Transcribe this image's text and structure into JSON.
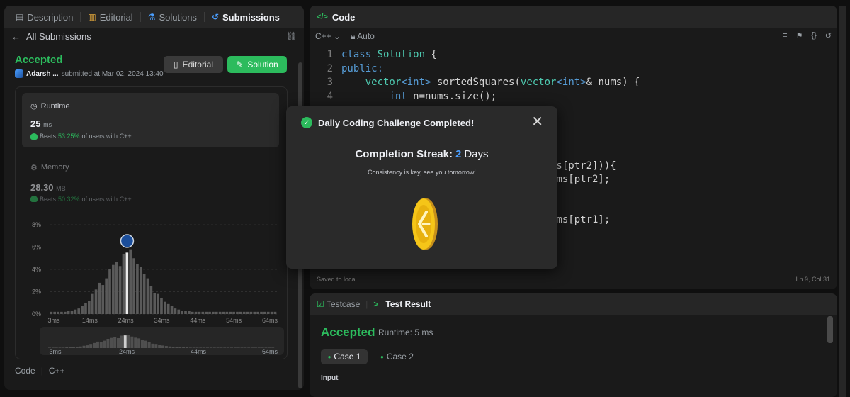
{
  "left_tabs": [
    {
      "icon": "description-icon",
      "label": "Description"
    },
    {
      "icon": "book-icon",
      "label": "Editorial"
    },
    {
      "icon": "flask-icon",
      "label": "Solutions"
    },
    {
      "icon": "history-icon",
      "label": "Submissions"
    }
  ],
  "submission": {
    "back_label": "All Submissions",
    "status": "Accepted",
    "user": "Adarsh ...",
    "submitted_text": "submitted at Mar 02, 2024 13:40",
    "editorial_btn": "Editorial",
    "solution_btn": "Solution"
  },
  "runtime": {
    "title": "Runtime",
    "value": "25",
    "unit": "ms",
    "beats_prefix": "Beats",
    "beats_pct": "53.25%",
    "beats_suffix": "of users with C++"
  },
  "memory": {
    "title": "Memory",
    "value": "28.30",
    "unit": "MB",
    "beats_prefix": "Beats",
    "beats_pct": "50.32%",
    "beats_suffix": "of users with C++"
  },
  "chart_data": {
    "type": "bar",
    "title": "",
    "xlabel": "",
    "ylabel": "",
    "ylim": [
      0,
      8
    ],
    "yticks": [
      "8%",
      "6%",
      "4%",
      "2%",
      "0%"
    ],
    "xticks": [
      "3ms",
      "14ms",
      "24ms",
      "34ms",
      "44ms",
      "54ms",
      "64ms"
    ],
    "mini_xticks": [
      "3ms",
      "24ms",
      "44ms",
      "64ms"
    ],
    "highlight_index": 22,
    "highlight_value": 5.5,
    "values": [
      0.2,
      0.2,
      0.2,
      0.2,
      0.2,
      0.3,
      0.3,
      0.4,
      0.5,
      0.7,
      1.0,
      1.2,
      1.8,
      2.2,
      2.8,
      2.6,
      3.2,
      4.0,
      4.4,
      4.7,
      4.3,
      5.4,
      5.5,
      5.8,
      5.0,
      4.5,
      4.2,
      3.6,
      3.2,
      2.5,
      1.9,
      1.8,
      1.4,
      1.1,
      0.9,
      0.7,
      0.5,
      0.4,
      0.3,
      0.3,
      0.3,
      0.2,
      0.2,
      0.2,
      0.2,
      0.2,
      0.2,
      0.2,
      0.2,
      0.2,
      0.2,
      0.2,
      0.2,
      0.2,
      0.2,
      0.2,
      0.2,
      0.2,
      0.2,
      0.2,
      0.2,
      0.2,
      0.2,
      0.2,
      0.2,
      0.2
    ]
  },
  "code_lang": {
    "code": "Code",
    "lang": "C++"
  },
  "editor": {
    "tab": "Code",
    "language": "C++",
    "mode": "Auto",
    "saved": "Saved to local",
    "position": "Ln 9, Col 31"
  },
  "code_lines": [
    {
      "no": "1"
    },
    {
      "no": "2"
    },
    {
      "no": "3"
    },
    {
      "no": "4"
    }
  ],
  "code_tokens": {
    "l1a": "class ",
    "l1b": "Solution",
    "l1c": " {",
    "l2": "public:",
    "l3a": "    vector",
    "l3b": "<int>",
    "l3c": " sortedSquares(",
    "l3d": "vector",
    "l3e": "<int>",
    "l3f": "& nums) {",
    "l4a": "        int",
    "l4b": " n=nums.size();"
  },
  "code_fragments": [
    "ms[ptr2])){",
    "ums[ptr2];",
    "ums[ptr1];"
  ],
  "result": {
    "tab_testcase": "Testcase",
    "tab_result": "Test Result",
    "status": "Accepted",
    "runtime": "Runtime: 5 ms",
    "case1": "Case 1",
    "case2": "Case 2",
    "input_label": "Input"
  },
  "modal": {
    "title": "Daily Coding Challenge Completed!",
    "streak_label": "Completion Streak:",
    "streak_num": "2",
    "streak_unit": "Days",
    "subtext": "Consistency is key, see you tomorrow!"
  },
  "colors": {
    "accent_green": "#2cbb5d",
    "accent_blue": "#4a9eff",
    "coin_gold": "#f5c518"
  }
}
